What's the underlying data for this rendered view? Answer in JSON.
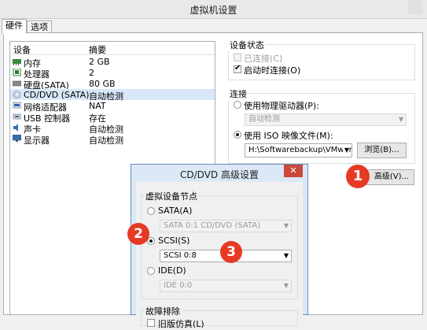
{
  "window": {
    "title": "虚拟机设置"
  },
  "tabs": [
    "硬件",
    "选项"
  ],
  "device_list": {
    "col_device": "设备",
    "col_summary": "摘要",
    "rows": [
      {
        "name": "内存",
        "summary": "2 GB",
        "icon": "memory-icon"
      },
      {
        "name": "处理器",
        "summary": "2",
        "icon": "processor-icon"
      },
      {
        "name": "硬盘(SATA)",
        "summary": "80 GB",
        "icon": "hard-disk-icon"
      },
      {
        "name": "CD/DVD (SATA)",
        "summary": "自动检测",
        "icon": "cd-dvd-icon"
      },
      {
        "name": "网络适配器",
        "summary": "NAT",
        "icon": "network-adapter-icon"
      },
      {
        "name": "USB 控制器",
        "summary": "存在",
        "icon": "usb-icon"
      },
      {
        "name": "声卡",
        "summary": "自动检测",
        "icon": "sound-card-icon"
      },
      {
        "name": "显示器",
        "summary": "自动检测",
        "icon": "display-icon"
      }
    ]
  },
  "device_status": {
    "title": "设备状态",
    "connected": "已连接(C)",
    "connect_on_power_on": "启动时连接(O)"
  },
  "connection": {
    "title": "连接",
    "use_physical": "使用物理驱动器(P):",
    "physical_value": "自动检测",
    "use_iso": "使用 ISO 映像文件(M):",
    "iso_path": "H:\\Softwarebackup\\VMware",
    "browse_label": "浏览(B)...",
    "advanced_label": "高级(V)..."
  },
  "dialog": {
    "title": "CD/DVD 高级设置",
    "close": "✕",
    "group_title": "虚拟设备节点",
    "sata_label": "SATA(A)",
    "sata_value": "SATA 0:1   CD/DVD (SATA)",
    "scsi_label": "SCSI(S)",
    "scsi_value": "SCSI 0:8",
    "ide_label": "IDE(D)",
    "ide_value": "IDE 0:0",
    "troubleshoot_title": "故障排除",
    "legacy_label": "旧版仿真(L)"
  },
  "badges": [
    "1",
    "2",
    "3"
  ],
  "colors": {
    "badge": "#e63a24",
    "selection": "#d9e8f9",
    "dialog_frame": "#dbe8f5",
    "close_button": "#c9493c"
  }
}
